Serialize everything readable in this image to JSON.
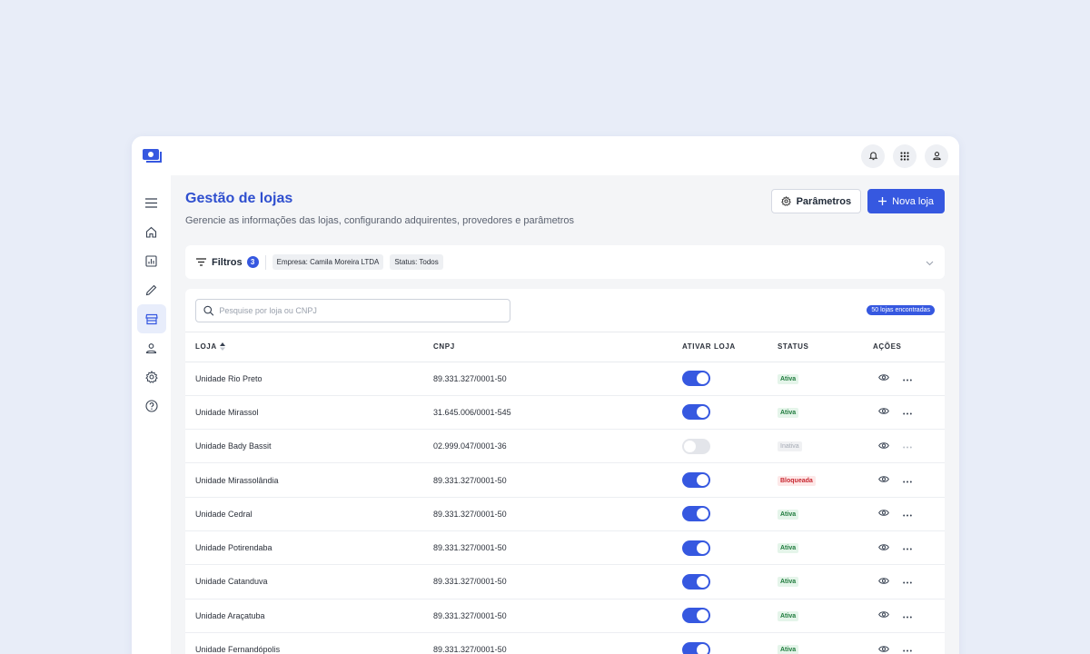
{
  "header": {
    "title": "Gestão de lojas",
    "subtitle": "Gerencie as informações das lojas, configurando adquirentes, provedores e parâmetros",
    "params_label": "Parâmetros",
    "new_label": "Nova loja"
  },
  "filters": {
    "label": "Filtros",
    "count": "3",
    "chips": [
      "Empresa: Camila Moreira LTDA",
      "Status: Todos"
    ]
  },
  "search": {
    "placeholder": "Pesquise por loja ou CNPJ"
  },
  "found": "50 lojas encontradas",
  "table": {
    "columns": [
      "LOJA",
      "CNPJ",
      "ATIVAR LOJA",
      "STATUS",
      "AÇÕES"
    ],
    "rows": [
      {
        "name": "Unidade Rio Preto",
        "cnpj": "89.331.327/0001-50",
        "active": true,
        "status": "Ativa"
      },
      {
        "name": "Unidade Mirassol",
        "cnpj": "31.645.006/0001-545",
        "active": true,
        "status": "Ativa"
      },
      {
        "name": "Unidade Bady Bassit",
        "cnpj": "02.999.047/0001-36",
        "active": false,
        "status": "Inativa"
      },
      {
        "name": "Unidade Mirassolândia",
        "cnpj": "89.331.327/0001-50",
        "active": true,
        "status": "Bloqueada"
      },
      {
        "name": "Unidade Cedral",
        "cnpj": "89.331.327/0001-50",
        "active": true,
        "status": "Ativa"
      },
      {
        "name": "Unidade Potirendaba",
        "cnpj": "89.331.327/0001-50",
        "active": true,
        "status": "Ativa"
      },
      {
        "name": "Unidade Catanduva",
        "cnpj": "89.331.327/0001-50",
        "active": true,
        "status": "Ativa"
      },
      {
        "name": "Unidade Araçatuba",
        "cnpj": "89.331.327/0001-50",
        "active": true,
        "status": "Ativa"
      },
      {
        "name": "Unidade Fernandópolis",
        "cnpj": "89.331.327/0001-50",
        "active": true,
        "status": "Ativa"
      }
    ]
  },
  "sidebar": {
    "items": [
      {
        "icon": "menu-icon",
        "active": false
      },
      {
        "icon": "home-icon",
        "active": false
      },
      {
        "icon": "chart-icon",
        "active": false
      },
      {
        "icon": "pencil-icon",
        "active": false
      },
      {
        "icon": "store-icon",
        "active": true
      },
      {
        "icon": "user-icon",
        "active": false
      },
      {
        "icon": "gear-icon",
        "active": false
      },
      {
        "icon": "help-icon",
        "active": false
      }
    ]
  },
  "colors": {
    "accent": "#3658e0",
    "title": "#2f4fcf",
    "status_ativa": "#1e7a3c",
    "status_bloqueada": "#c8262f",
    "status_inativa": "#a6abb5"
  }
}
